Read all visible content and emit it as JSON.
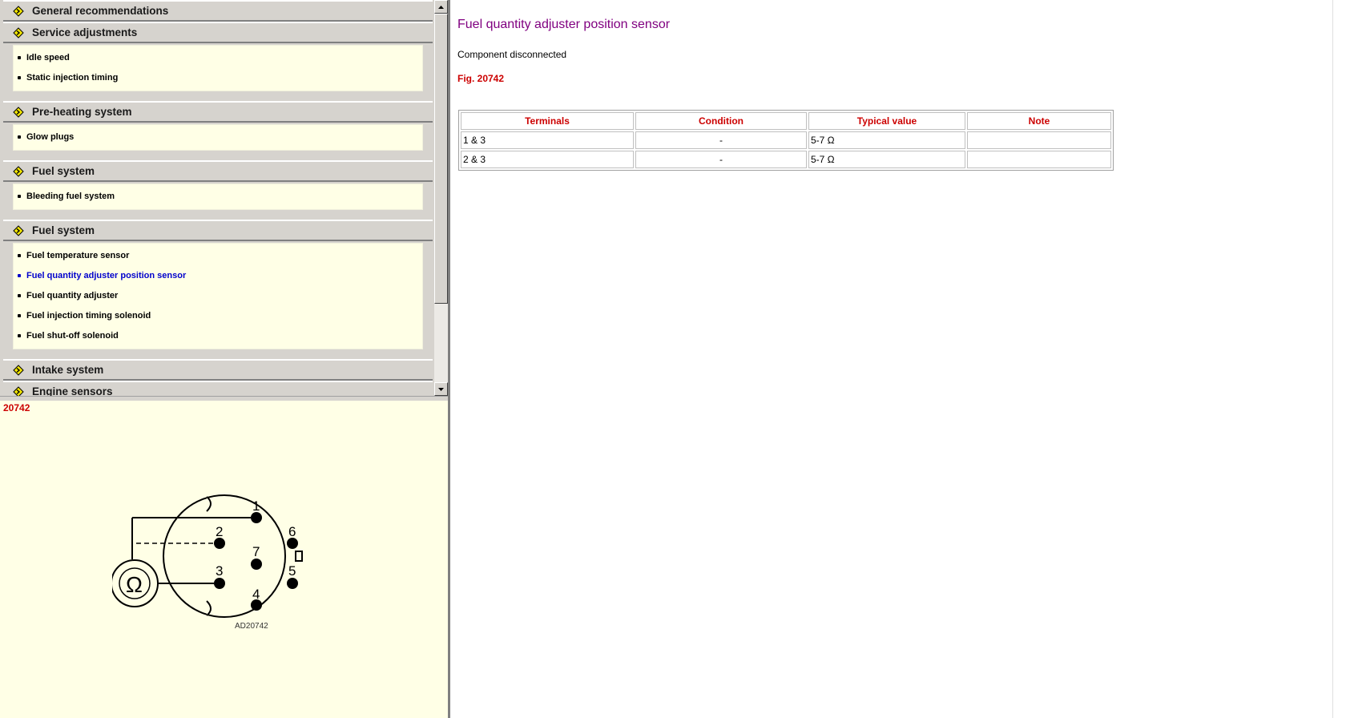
{
  "nav": {
    "sections": [
      {
        "title": "General recommendations",
        "expanded": false,
        "items": []
      },
      {
        "title": "Service adjustments",
        "expanded": true,
        "items": [
          "Idle speed",
          "Static injection timing"
        ]
      },
      {
        "title": "Pre-heating system",
        "expanded": true,
        "items": [
          "Glow plugs"
        ]
      },
      {
        "title": "Fuel system",
        "expanded": true,
        "items": [
          "Bleeding fuel system"
        ]
      },
      {
        "title": "Fuel system",
        "expanded": true,
        "items": [
          "Fuel temperature sensor",
          "Fuel quantity adjuster position sensor",
          "Fuel quantity adjuster",
          "Fuel injection timing solenoid",
          "Fuel shut-off solenoid"
        ],
        "active_item": 1
      },
      {
        "title": "Intake system",
        "expanded": false,
        "items": []
      },
      {
        "title": "Engine sensors",
        "expanded": false,
        "items": []
      }
    ]
  },
  "figure": {
    "number": "20742",
    "caption": "AD20742",
    "ohm_symbol": "Ω",
    "pins": [
      "1",
      "2",
      "3",
      "4",
      "5",
      "6",
      "7"
    ]
  },
  "content": {
    "title": "Fuel quantity adjuster position sensor",
    "status": "Component disconnected",
    "figure_ref": "Fig. 20742",
    "table": {
      "headers": [
        "Terminals",
        "Condition",
        "Typical value",
        "Note"
      ],
      "rows": [
        [
          "1 & 3",
          "-",
          "5-7 Ω",
          ""
        ],
        [
          "2 & 3",
          "-",
          "5-7 Ω",
          ""
        ]
      ]
    }
  },
  "colors": {
    "panel_bg": "#d6d3ce",
    "item_bg": "#ffffe6",
    "title_purple": "#800080",
    "red": "#cc0000",
    "link_blue": "#0000cc"
  }
}
